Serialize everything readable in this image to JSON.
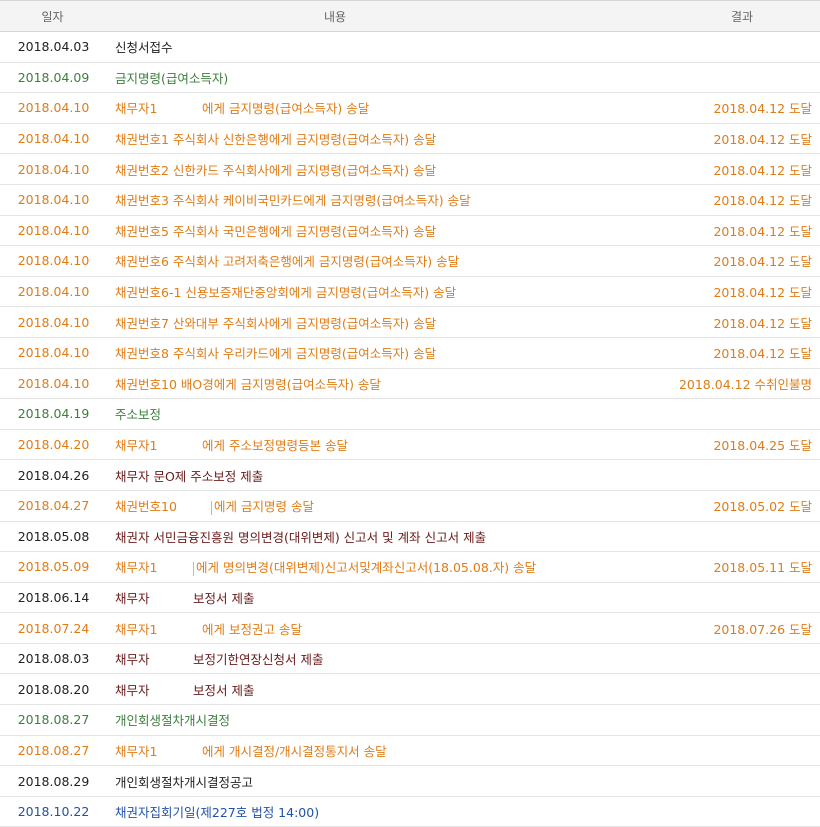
{
  "headers": {
    "date": "일자",
    "content": "내용",
    "result": "결과"
  },
  "rows": [
    {
      "date": "2018.04.03",
      "prefix": "",
      "content": "신청서접수",
      "result": ""
    },
    {
      "date": "2018.04.09",
      "prefix": "",
      "content": "금지명령(급여소득자)",
      "result": ""
    },
    {
      "date": "2018.04.10",
      "prefix": "채무자1",
      "content": "에게 금지명령(급여소득자) 송달",
      "result": "2018.04.12 도달"
    },
    {
      "date": "2018.04.10",
      "prefix": "",
      "content": "채권번호1 주식회사 신한은행에게 금지명령(급여소득자) 송달",
      "result": "2018.04.12 도달"
    },
    {
      "date": "2018.04.10",
      "prefix": "",
      "content": "채권번호2 신한카드 주식회사에게 금지명령(급여소득자) 송달",
      "result": "2018.04.12 도달"
    },
    {
      "date": "2018.04.10",
      "prefix": "",
      "content": "채권번호3 주식회사 케이비국민카드에게 금지명령(급여소득자) 송달",
      "result": "2018.04.12 도달"
    },
    {
      "date": "2018.04.10",
      "prefix": "",
      "content": "채권번호5 주식회사 국민은행에게 금지명령(급여소득자) 송달",
      "result": "2018.04.12 도달"
    },
    {
      "date": "2018.04.10",
      "prefix": "",
      "content": "채권번호6 주식회사 고려저축은행에게 금지명령(급여소득자) 송달",
      "result": "2018.04.12 도달"
    },
    {
      "date": "2018.04.10",
      "prefix": "",
      "content": "채권번호6-1 신용보증재단중앙회에게 금지명령(급여소득자) 송달",
      "result": "2018.04.12 도달"
    },
    {
      "date": "2018.04.10",
      "prefix": "",
      "content": "채권번호7 산와대부 주식회사에게 금지명령(급여소득자) 송달",
      "result": "2018.04.12 도달"
    },
    {
      "date": "2018.04.10",
      "prefix": "",
      "content": "채권번호8 주식회사 우리카드에게 금지명령(급여소득자) 송달",
      "result": "2018.04.12 도달"
    },
    {
      "date": "2018.04.10",
      "prefix": "",
      "content": "채권번호10 배O경에게 금지명령(급여소득자) 송달",
      "result": "2018.04.12 수취인불명"
    },
    {
      "date": "2018.04.19",
      "prefix": "",
      "content": "주소보정",
      "result": ""
    },
    {
      "date": "2018.04.20",
      "prefix": "채무자1",
      "content": "에게 주소보정명령등본 송달",
      "result": "2018.04.25 도달"
    },
    {
      "date": "2018.04.26",
      "prefix": "",
      "content": "채무자 문O제 주소보정 제출",
      "result": ""
    },
    {
      "date": "2018.04.27",
      "prefix": "채권번호10",
      "content": "에게 금지명령 송달",
      "result": "2018.05.02 도달"
    },
    {
      "date": "2018.05.08",
      "prefix": "",
      "content": "채권자 서민금융진흥원 명의변경(대위변제) 신고서 및 계좌 신고서 제출",
      "result": ""
    },
    {
      "date": "2018.05.09",
      "prefix": "채무자1",
      "content": "에게 명의변경(대위변제)신고서및계좌신고서(18.05.08.자) 송달",
      "result": "2018.05.11 도달"
    },
    {
      "date": "2018.06.14",
      "prefix": "채무자",
      "content": "보정서 제출",
      "result": ""
    },
    {
      "date": "2018.07.24",
      "prefix": "채무자1",
      "content": "에게 보정권고 송달",
      "result": "2018.07.26 도달"
    },
    {
      "date": "2018.08.03",
      "prefix": "채무자",
      "content": "보정기한연장신청서 제출",
      "result": ""
    },
    {
      "date": "2018.08.20",
      "prefix": "채무자",
      "content": "보정서 제출",
      "result": ""
    },
    {
      "date": "2018.08.27",
      "prefix": "",
      "content": "개인회생절차개시결정",
      "result": ""
    },
    {
      "date": "2018.08.27",
      "prefix": "채무자1",
      "content": "에게 개시결정/개시결정통지서 송달",
      "result": ""
    },
    {
      "date": "2018.08.29",
      "prefix": "",
      "content": "개인회생절차개시결정공고",
      "result": ""
    },
    {
      "date": "2018.10.22",
      "prefix": "",
      "content": "채권자집회기일(제227호 법정 14:00)",
      "result": ""
    }
  ],
  "colors": {
    "receipt": "#222222",
    "court_order": "#3c7f3c",
    "service": "#e07c16",
    "party_submission": "#6b1b1b",
    "hearing": "#2252a8"
  }
}
